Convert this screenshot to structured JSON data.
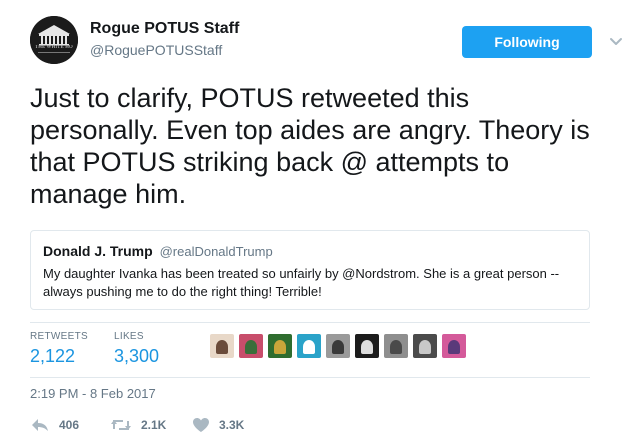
{
  "tweet": {
    "author": {
      "display_name": "Rogue POTUS Staff",
      "handle": "@RoguePOTUSStaff",
      "avatar_caption": "THE WHITE HOUSE"
    },
    "follow_button_label": "Following",
    "text": "Just to clarify, POTUS retweeted this personally. Even top aides are angry. Theory is that POTUS striking back @ attempts to manage him.",
    "quoted": {
      "display_name": "Donald J. Trump",
      "handle": "@realDonaldTrump",
      "text": "My daughter Ivanka has been treated so unfairly by @Nordstrom. She is a great person -- always pushing me to do the right thing! Terrible!"
    },
    "stats": {
      "retweets_label": "RETWEETS",
      "retweets_value": "2,122",
      "likes_label": "LIKES",
      "likes_value": "3,300"
    },
    "likers": [
      {
        "name": "liker-avatar-1",
        "color": "#e8d8c8",
        "accent": "#6a4b3a"
      },
      {
        "name": "liker-avatar-2",
        "color": "#c84d6b",
        "accent": "#3a6e3a"
      },
      {
        "name": "liker-avatar-3",
        "color": "#2f6d2f",
        "accent": "#c9a63a"
      },
      {
        "name": "liker-avatar-4",
        "color": "#2aa3c9",
        "accent": "#ffffff"
      },
      {
        "name": "liker-avatar-5",
        "color": "#9a9a9a",
        "accent": "#3a3a3a"
      },
      {
        "name": "liker-avatar-6",
        "color": "#1c1c1c",
        "accent": "#dddddd"
      },
      {
        "name": "liker-avatar-7",
        "color": "#8e8e8e",
        "accent": "#4a4a4a"
      },
      {
        "name": "liker-avatar-8",
        "color": "#4b4b4b",
        "accent": "#c8c8c8"
      },
      {
        "name": "liker-avatar-9",
        "color": "#d45a9a",
        "accent": "#5a3a7a"
      }
    ],
    "timestamp": "2:19 PM - 8 Feb 2017",
    "actions": {
      "reply_count": "406",
      "retweet_count": "2.1K",
      "like_count": "3.3K"
    }
  }
}
